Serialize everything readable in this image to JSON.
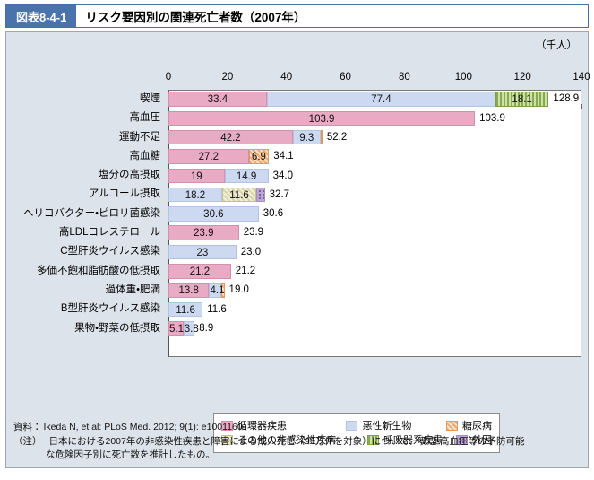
{
  "header": {
    "tag": "図表8-4-1",
    "title": "リスク要因別の関連死亡者数（2007年）"
  },
  "unit": "（千人）",
  "chart_data": {
    "type": "bar",
    "orientation": "horizontal",
    "stacked": true,
    "title": "リスク要因別の関連死亡者数（2007年）",
    "xlabel": "（千人）",
    "ylabel": "",
    "xlim": [
      0,
      140
    ],
    "xticks": [
      0,
      20,
      40,
      60,
      80,
      100,
      120,
      140
    ],
    "grid": false,
    "legend_position": "bottom",
    "series": [
      {
        "key": "cardio",
        "name": "循環器疾患",
        "color": "#e9aac4",
        "pattern": "solid"
      },
      {
        "key": "cancer",
        "name": "悪性新生物",
        "color": "#ccd9f0",
        "pattern": "solid"
      },
      {
        "key": "diabetes",
        "name": "糖尿病",
        "color": "#f0a868",
        "pattern": "diagonal-stripe"
      },
      {
        "key": "othernc",
        "name": "その他の非感染性疾病",
        "color": "#d8d5a8",
        "pattern": "diagonal-stripe"
      },
      {
        "key": "resp",
        "name": "呼吸器系疾患",
        "color": "#86ab4e",
        "pattern": "vertical-stripe"
      },
      {
        "key": "external",
        "name": "外因",
        "color": "#bda6d4",
        "pattern": "dotted"
      }
    ],
    "categories": [
      "喫煙",
      "高血圧",
      "運動不足",
      "高血糖",
      "塩分の高摂取",
      "アルコール摂取",
      "ヘリコバクター・ピロリ菌感染",
      "高LDLコレステロール",
      "C型肝炎ウイルス感染",
      "多価不飽和脂肪酸の低摂取",
      "過体重・肥満",
      "B型肝炎ウイルス感染",
      "果物・野菜の低摂取"
    ],
    "rows": [
      {
        "category": "喫煙",
        "total": "128.9",
        "total_value": 128.9,
        "segments": [
          {
            "series": "cardio",
            "value": 33.4,
            "label": "33.4"
          },
          {
            "series": "cancer",
            "value": 77.4,
            "label": "77.4"
          },
          {
            "series": "resp",
            "value": 18.1,
            "label": "18.1"
          }
        ]
      },
      {
        "category": "高血圧",
        "total": "103.9",
        "total_value": 103.9,
        "segments": [
          {
            "series": "cardio",
            "value": 103.9,
            "label": "103.9"
          }
        ]
      },
      {
        "category": "運動不足",
        "total": "52.2",
        "total_value": 52.2,
        "segments": [
          {
            "series": "cardio",
            "value": 42.2,
            "label": "42.2"
          },
          {
            "series": "cancer",
            "value": 9.3,
            "label": "9.3"
          },
          {
            "series": "diabetes",
            "value": 0.7,
            "label": ""
          }
        ]
      },
      {
        "category": "高血糖",
        "total": "34.1",
        "total_value": 34.1,
        "segments": [
          {
            "series": "cardio",
            "value": 27.2,
            "label": "27.2"
          },
          {
            "series": "diabetes",
            "value": 6.9,
            "label": "6.9"
          }
        ]
      },
      {
        "category": "塩分の高摂取",
        "total": "34.0",
        "total_value": 34.0,
        "segments": [
          {
            "series": "cardio",
            "value": 19.0,
            "label": "19"
          },
          {
            "series": "cancer",
            "value": 14.9,
            "label": "14.9"
          }
        ]
      },
      {
        "category": "アルコール摂取",
        "total": "32.7",
        "total_value": 32.7,
        "segments": [
          {
            "series": "cancer",
            "value": 18.2,
            "label": "18.2"
          },
          {
            "series": "othernc",
            "value": 11.6,
            "label": "11.6"
          },
          {
            "series": "external",
            "value": 2.9,
            "label": ""
          }
        ]
      },
      {
        "category": "ヘリコバクター・ピロリ菌感染",
        "total": "30.6",
        "total_value": 30.6,
        "segments": [
          {
            "series": "cancer",
            "value": 30.6,
            "label": "30.6"
          }
        ]
      },
      {
        "category": "高LDLコレステロール",
        "total": "23.9",
        "total_value": 23.9,
        "segments": [
          {
            "series": "cardio",
            "value": 23.9,
            "label": "23.9"
          }
        ]
      },
      {
        "category": "C型肝炎ウイルス感染",
        "total": "23.0",
        "total_value": 23.0,
        "segments": [
          {
            "series": "cancer",
            "value": 23.0,
            "label": "23"
          }
        ]
      },
      {
        "category": "多価不飽和脂肪酸の低摂取",
        "total": "21.2",
        "total_value": 21.2,
        "segments": [
          {
            "series": "cardio",
            "value": 21.2,
            "label": "21.2"
          }
        ]
      },
      {
        "category": "過体重・肥満",
        "total": "19.0",
        "total_value": 19.0,
        "segments": [
          {
            "series": "cardio",
            "value": 13.8,
            "label": "13.8"
          },
          {
            "series": "cancer",
            "value": 4.1,
            "label": "4.1"
          },
          {
            "series": "diabetes",
            "value": 1.1,
            "label": ""
          }
        ]
      },
      {
        "category": "B型肝炎ウイルス感染",
        "total": "11.6",
        "total_value": 11.6,
        "segments": [
          {
            "series": "cancer",
            "value": 11.6,
            "label": "11.6"
          }
        ]
      },
      {
        "category": "果物・野菜の低摂取",
        "total": "8.9",
        "total_value": 8.9,
        "segments": [
          {
            "series": "cardio",
            "value": 5.1,
            "label": "5.1"
          },
          {
            "series": "cancer",
            "value": 3.8,
            "label": "3.8"
          }
        ]
      }
    ]
  },
  "legend": {
    "row1": [
      {
        "key": "cardio",
        "label": "循環器疾患"
      },
      {
        "key": "cancer",
        "label": "悪性新生物"
      },
      {
        "key": "diabetes",
        "label": "糖尿病"
      }
    ],
    "row2": [
      {
        "key": "othernc",
        "label": "その他の非感染性疾病"
      },
      {
        "key": "resp",
        "label": "呼吸器系疾患"
      },
      {
        "key": "external",
        "label": "外因"
      }
    ]
  },
  "notes": {
    "source_key": "資料：",
    "source_text": "Ikeda N, et al: PLoS Med. 2012; 9(1): e1001160.",
    "note_key": "（注）",
    "note_text": "日本における2007年の非感染性疾患と障害による成人死亡（96万件を対象）について、喫煙・高血圧等の予防可能",
    "note_text2": "な危険因子別に死亡数を推計したもの。"
  }
}
